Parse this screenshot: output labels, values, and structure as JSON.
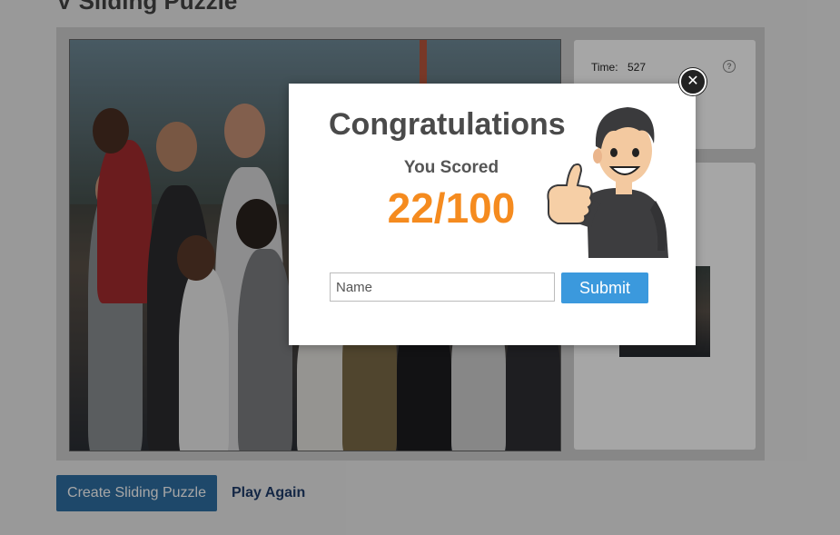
{
  "page": {
    "title": "V Sliding Puzzle"
  },
  "stats": {
    "time_label": "Time:",
    "time_value": "527",
    "help_icon": "question-circle-icon"
  },
  "modal": {
    "title": "Congratulations",
    "score_label": "You Scored",
    "score_value": "22/100",
    "name_placeholder": "Name",
    "name_value": "",
    "submit_label": "Submit",
    "close_icon": "close-icon",
    "mascot": "thumbs-up-man-illustration"
  },
  "actions": {
    "create_label": "Create Sliding Puzzle",
    "play_again_label": "Play Again"
  },
  "colors": {
    "score": "#f58b1f",
    "submit": "#3b99dd",
    "create": "#2f6fa3",
    "link": "#1f3d6b"
  }
}
